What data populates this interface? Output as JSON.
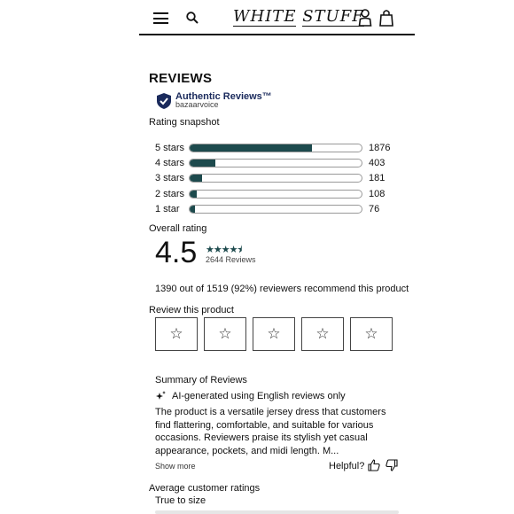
{
  "header": {
    "logo_left": "WHITE",
    "logo_right": "STUFF"
  },
  "reviews": {
    "title": "REVIEWS",
    "badge_title": "Authentic Reviews™",
    "badge_sub": "bazaarvoice",
    "snapshot_label": "Rating snapshot",
    "histogram": [
      {
        "label": "5 stars",
        "count": "1876",
        "fraction": 0.71
      },
      {
        "label": "4 stars",
        "count": "403",
        "fraction": 0.15
      },
      {
        "label": "3 stars",
        "count": "181",
        "fraction": 0.07
      },
      {
        "label": "2 stars",
        "count": "108",
        "fraction": 0.04
      },
      {
        "label": "1 star",
        "count": "76",
        "fraction": 0.03
      }
    ],
    "overall_label": "Overall rating",
    "overall_value": "4.5",
    "overall_stars": "★★★★⯨",
    "review_count": "2644 Reviews",
    "recommend_text": "1390 out of 1519 (92%) reviewers recommend this product",
    "review_this_label": "Review this product",
    "star_glyph": "☆",
    "summary_title": "Summary of Reviews",
    "ai_note": "AI-generated using English reviews only",
    "summary_body": "The product is a versatile jersey dress that customers find flattering, comfortable, and suitable for various occasions. Reviewers praise its stylish yet casual appearance, pockets, and midi length. M...",
    "show_more": "Show more",
    "helpful_label": "Helpful?",
    "avg_title": "Average customer ratings",
    "true_to_size": "True to size"
  },
  "colors": {
    "accent": "#1d4a4d",
    "badge_blue": "#1a2a5c"
  }
}
